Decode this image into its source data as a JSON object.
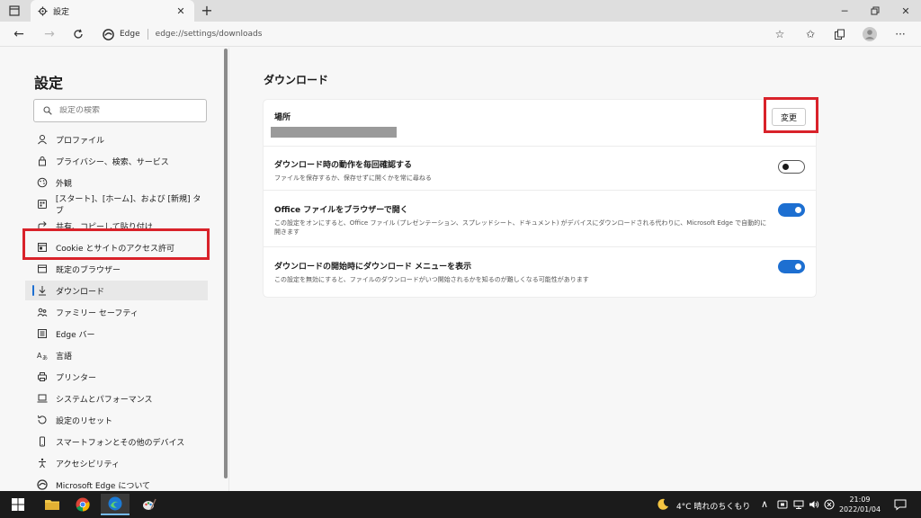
{
  "browser": {
    "tab_title": "設定",
    "addr_label": "Edge",
    "url": "edge://settings/downloads"
  },
  "sidebar": {
    "title": "設定",
    "search_placeholder": "設定の検索",
    "items": [
      {
        "label": "プロファイル",
        "icon": "profile-icon"
      },
      {
        "label": "プライバシー、検索、サービス",
        "icon": "lock-icon"
      },
      {
        "label": "外観",
        "icon": "appearance-icon"
      },
      {
        "label": "[スタート]、[ホーム]、および [新規] タブ",
        "icon": "start-icon"
      },
      {
        "label": "共有、コピーして貼り付け",
        "icon": "share-icon"
      },
      {
        "label": "Cookie とサイトのアクセス許可",
        "icon": "cookie-icon"
      },
      {
        "label": "既定のブラウザー",
        "icon": "browser-icon"
      },
      {
        "label": "ダウンロード",
        "icon": "download-icon",
        "active": true
      },
      {
        "label": "ファミリー セーフティ",
        "icon": "family-icon"
      },
      {
        "label": "Edge バー",
        "icon": "edge-bar-icon"
      },
      {
        "label": "言語",
        "icon": "language-icon"
      },
      {
        "label": "プリンター",
        "icon": "printer-icon"
      },
      {
        "label": "システムとパフォーマンス",
        "icon": "system-icon"
      },
      {
        "label": "設定のリセット",
        "icon": "reset-icon"
      },
      {
        "label": "スマートフォンとその他のデバイス",
        "icon": "phone-icon"
      },
      {
        "label": "アクセシビリティ",
        "icon": "accessibility-icon"
      },
      {
        "label": "Microsoft Edge について",
        "icon": "edge-icon"
      }
    ]
  },
  "main": {
    "title": "ダウンロード",
    "location": {
      "label": "場所",
      "button": "変更"
    },
    "ask": {
      "label": "ダウンロード時の動作を毎回確認する",
      "desc": "ファイルを保存するか、保存せずに開くかを常に尋ねる",
      "on": false
    },
    "office": {
      "label": "Office ファイルをブラウザーで開く",
      "desc": "この設定をオンにすると、Office ファイル (プレゼンテーション、スプレッドシート、ドキュメント) がデバイスにダウンロードされる代わりに、Microsoft Edge で自動的に開きます",
      "on": true
    },
    "menu": {
      "label": "ダウンロードの開始時にダウンロード メニューを表示",
      "desc": "この設定を無効にすると、ファイルのダウンロードがいつ開始されるかを知るのが難しくなる可能性があります",
      "on": true
    }
  },
  "taskbar": {
    "weather": "4°C 晴れのちくもり",
    "time": "21:09",
    "date": "2022/01/04"
  },
  "colors": {
    "accent": "#1d6fd1",
    "highlight": "#d9222a"
  }
}
